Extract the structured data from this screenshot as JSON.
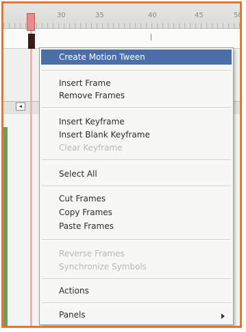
{
  "timeline": {
    "ruler_numbers": [
      "30",
      "35",
      "40",
      "45",
      "50"
    ]
  },
  "context_menu": {
    "items": [
      {
        "label": "Create Motion Tween",
        "enabled": true,
        "highlighted": true
      },
      {
        "label": "Insert Frame",
        "enabled": true
      },
      {
        "label": "Remove Frames",
        "enabled": true
      },
      {
        "label": "Insert Keyframe",
        "enabled": true
      },
      {
        "label": "Insert Blank Keyframe",
        "enabled": true
      },
      {
        "label": "Clear Keyframe",
        "enabled": false
      },
      {
        "label": "Select All",
        "enabled": true
      },
      {
        "label": "Cut Frames",
        "enabled": true
      },
      {
        "label": "Copy Frames",
        "enabled": true
      },
      {
        "label": "Paste Frames",
        "enabled": true
      },
      {
        "label": "Reverse Frames",
        "enabled": false
      },
      {
        "label": "Synchronize Symbols",
        "enabled": false
      },
      {
        "label": "Actions",
        "enabled": true
      },
      {
        "label": "Panels",
        "enabled": true,
        "submenu": true
      }
    ]
  },
  "colors": {
    "highlight": "#4a6fa8",
    "border_accent": "#e8732a"
  },
  "icons": {
    "submenu": "arrow-right-icon"
  }
}
